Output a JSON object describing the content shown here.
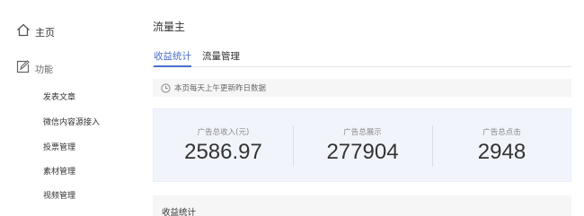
{
  "app_title": "流量主",
  "sidebar": {
    "home_label": "主页",
    "function_label": "功能",
    "items": [
      {
        "label": "发表文章"
      },
      {
        "label": "微信内容源接入"
      },
      {
        "label": "投票管理"
      },
      {
        "label": "素材管理"
      },
      {
        "label": "视频管理"
      }
    ]
  },
  "tabs": [
    {
      "label": "收益统计",
      "active": true
    },
    {
      "label": "流量管理",
      "active": false
    }
  ],
  "notice": {
    "text": "本页每天上午更新昨日数据",
    "icon": "clock-icon"
  },
  "stats": [
    {
      "label": "广告总收入(元)",
      "value": "2586.97"
    },
    {
      "label": "广告总展示",
      "value": "277904"
    },
    {
      "label": "广告总点击",
      "value": "2948"
    }
  ],
  "bottom_section": {
    "title": "收益统计"
  },
  "colors": {
    "accent": "#4a6fc9",
    "stats_bg": "#f1f5fb",
    "notice_bg": "#f6f6f6"
  }
}
